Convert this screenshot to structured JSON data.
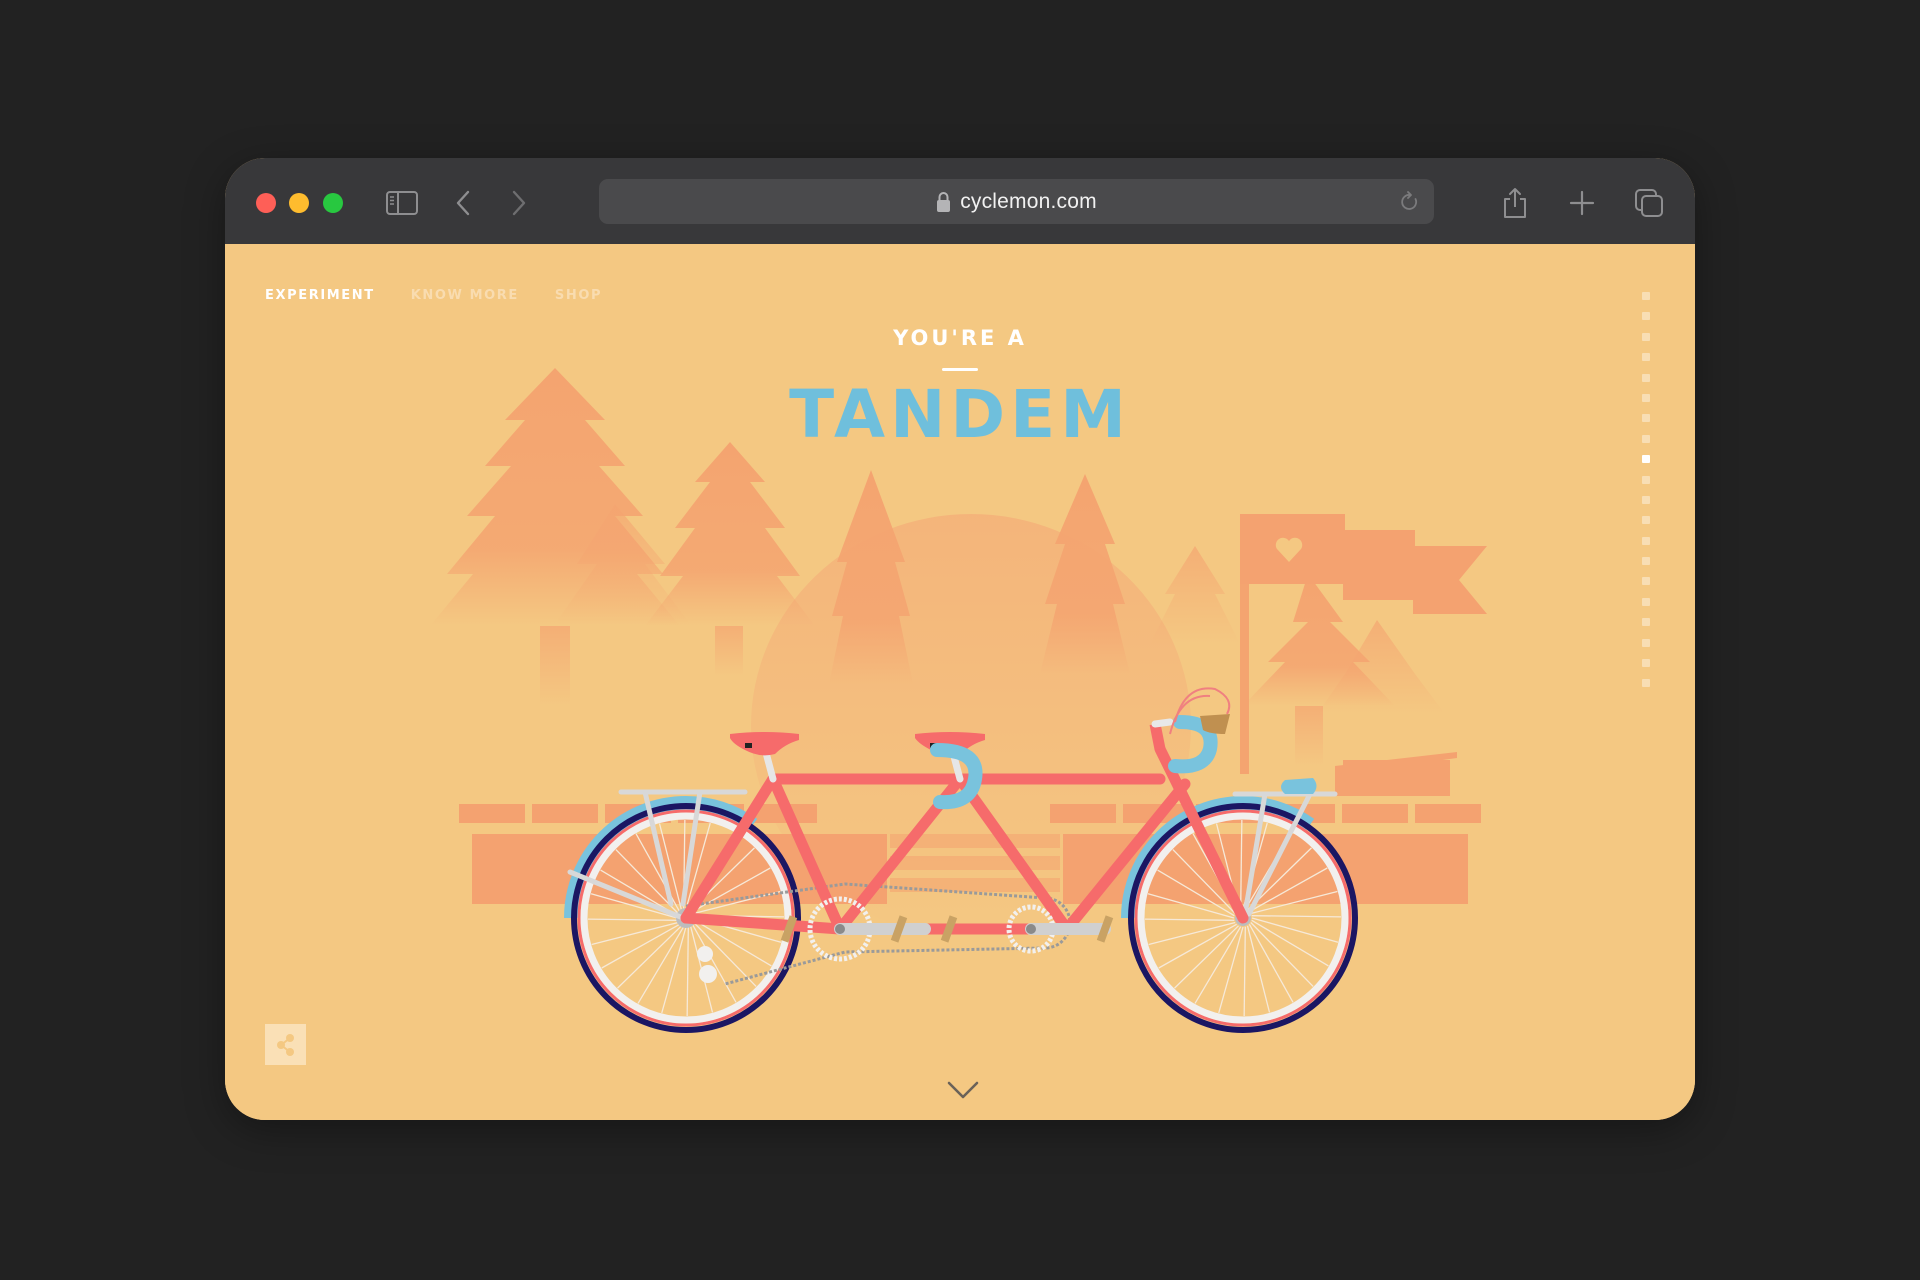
{
  "browser": {
    "url": "cyclemon.com",
    "icons": {
      "close": "traffic-light-red",
      "minimize": "traffic-light-yellow",
      "zoom": "traffic-light-green",
      "sidebar": "sidebar-icon",
      "back": "chevron-left-icon",
      "forward": "chevron-right-icon",
      "lock": "lock-icon",
      "reload": "reload-icon",
      "share": "share-icon",
      "new_tab": "plus-icon",
      "tabs": "tabs-overview-icon"
    }
  },
  "page": {
    "nav": [
      {
        "label": "EXPERIMENT",
        "active": true
      },
      {
        "label": "KNOW MORE",
        "active": false
      },
      {
        "label": "SHOP",
        "active": false
      }
    ],
    "subtitle": "YOU'RE A",
    "title": "TANDEM",
    "pager": {
      "total": 20,
      "active_index": 8
    },
    "share_icon": "share-nodes-icon",
    "scroll_icon": "chevron-down-icon",
    "illustration": "tandem-bicycle-scene",
    "colors": {
      "background": "#f4c882",
      "title": "#6fbfdc",
      "frame": "#f66b6b",
      "scenery": "#f4a470",
      "fender": "#79c3dd",
      "tire": "#1b1663"
    }
  }
}
